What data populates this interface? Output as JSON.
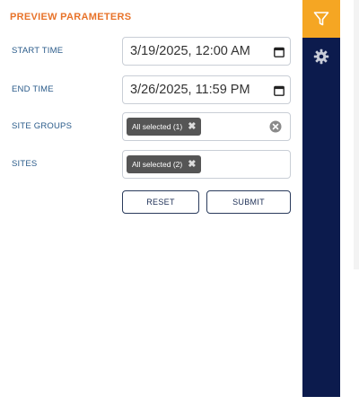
{
  "panel": {
    "title": "PREVIEW PARAMETERS"
  },
  "fields": {
    "start_time": {
      "label": "START TIME",
      "value": "3/19/2025, 12:00 AM",
      "icon": "calendar-icon"
    },
    "end_time": {
      "label": "END TIME",
      "value": "3/26/2025, 11:59 PM",
      "icon": "calendar-icon"
    },
    "site_groups": {
      "label": "SITE GROUPS",
      "chip": "All selected (1)",
      "chip_remove": "✖",
      "clear_icon": "clear-circle-icon"
    },
    "sites": {
      "label": "SITES",
      "chip": "All selected (2)",
      "chip_remove": "✖"
    }
  },
  "buttons": {
    "reset": "RESET",
    "submit": "SUBMIT"
  },
  "sidebar": {
    "items": [
      {
        "icon": "filter-icon",
        "active": true
      },
      {
        "icon": "gear-icon",
        "active": false
      }
    ]
  },
  "colors": {
    "title_accent": "#e8732a",
    "label": "#2a5b8a",
    "sidebar_bg": "#0c1b4d",
    "sidebar_active": "#f5a623",
    "chip_bg": "#555555"
  }
}
